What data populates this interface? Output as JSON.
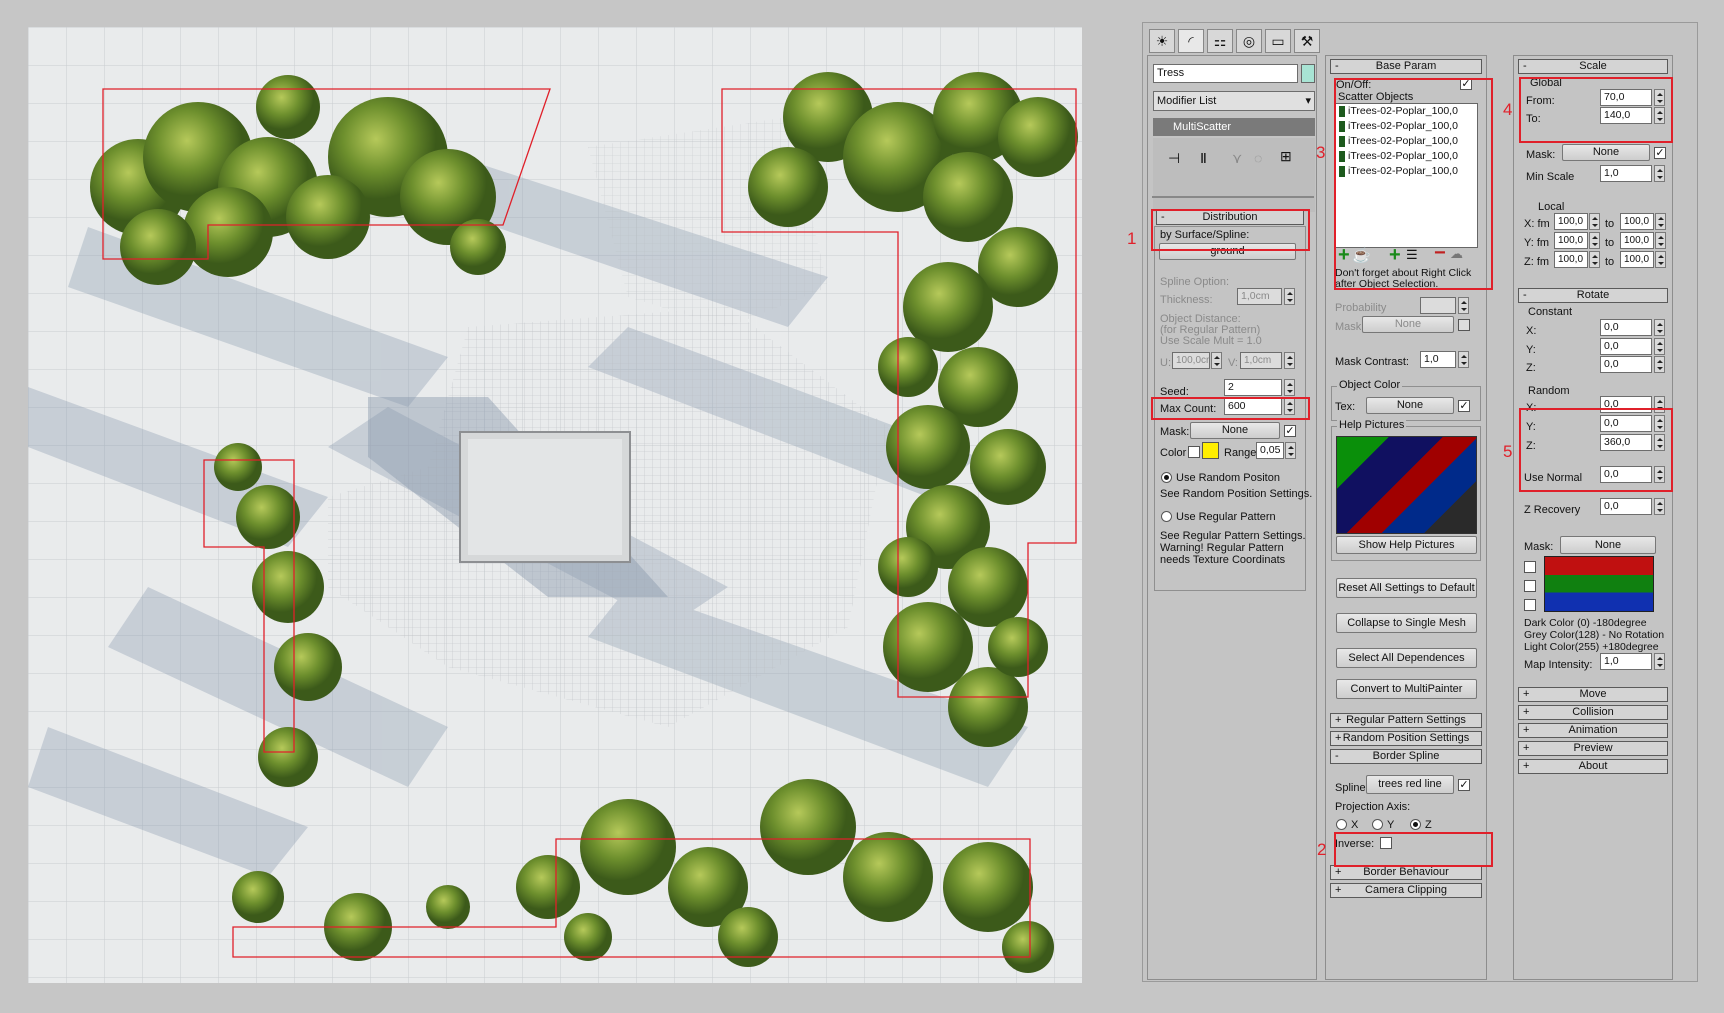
{
  "tabs": [
    "create-tab",
    "modify-tab",
    "hierarchy-tab",
    "motion-tab",
    "display-tab",
    "utilities-tab"
  ],
  "object_name": "Tress",
  "object_color": "#a8e4d4",
  "modifier_list": "Modifier List",
  "modifier_stack_item": "MultiScatter",
  "distribution": {
    "title": "Distribution",
    "by_surface_label": "by Surface/Spline:",
    "surface_button": "ground",
    "spline_option": "Spline Option:",
    "thickness_label": "Thickness:",
    "thickness_value": "1,0cm",
    "object_distance": "Object Distance:",
    "for_regular": "(for Regular Pattern)",
    "use_scale": "Use Scale Mult = 1.0",
    "u_label": "U:",
    "u_value": "100,0cr",
    "v_label": "V:",
    "v_value": "1,0cm",
    "seed_label": "Seed:",
    "seed_value": "2",
    "maxcount_label": "Max Count:",
    "maxcount_value": "600",
    "mask_label": "Mask:",
    "mask_value": "None",
    "color_label": "Color",
    "color_swatch": "#ffee00",
    "range_label": "Range",
    "range_value": "0,05",
    "use_random": "Use Random Positon",
    "see_random": "See Random Position Settings.",
    "use_regular": "Use Regular Pattern",
    "see_regular_1": "See Regular Pattern Settings.",
    "see_regular_2": "Warning! Regular Pattern",
    "see_regular_3": "needs Texture Coordinats"
  },
  "base": {
    "title": "Base Param",
    "onoff": "On/Off:",
    "scatter_objects": "Scatter Objects",
    "items": [
      "iTrees-02-Poplar_100,0",
      "iTrees-02-Poplar_100,0",
      "iTrees-02-Poplar_100,0",
      "iTrees-02-Poplar_100,0",
      "iTrees-02-Poplar_100,0"
    ],
    "note_1": "Don't forget about Right Click",
    "note_2": "after Object Selection.",
    "probability": "Probability",
    "mask_label": "Mask",
    "mask_value": "None",
    "mask_contrast": "Mask Contrast:",
    "mask_contrast_value": "1,0",
    "object_color": "Object Color",
    "tex_label": "Tex:",
    "tex_value": "None",
    "help_pictures": "Help Pictures",
    "show_help": "Show Help Pictures",
    "reset": "Reset All Settings to Default",
    "collapse": "Collapse to Single Mesh",
    "select_all": "Select All Dependences",
    "convert": "Convert to MultiPainter",
    "regular_pattern": "Regular Pattern Settings",
    "random_position": "Random Position Settings",
    "border_spline": "Border Spline",
    "spline_label": "Spline:",
    "spline_value": "trees red line",
    "projection_axis": "Projection Axis:",
    "axis_x": "X",
    "axis_y": "Y",
    "axis_z": "Z",
    "inverse": "Inverse:",
    "border_behaviour": "Border Behaviour",
    "camera_clipping": "Camera Clipping"
  },
  "scale": {
    "title": "Scale",
    "global": "Global",
    "from_label": "From:",
    "from_value": "70,0",
    "to_label": "To:",
    "to_value": "140,0",
    "mask_label": "Mask:",
    "mask_value": "None",
    "min_scale": "Min Scale",
    "min_scale_value": "1,0",
    "local": "Local",
    "x_fm": "X: fm",
    "y_fm": "Y: fm",
    "z_fm": "Z: fm",
    "to": "to",
    "local_value": "100,0"
  },
  "rotate": {
    "title": "Rotate",
    "constant": "Constant",
    "x": "X:",
    "y": "Y:",
    "z": "Z:",
    "zero": "0,0",
    "random": "Random",
    "rx": "0,0",
    "ry": "0,0",
    "rz": "360,0",
    "use_normal": "Use Normal",
    "use_normal_value": "0,0",
    "z_recovery": "Z Recovery",
    "z_recovery_value": "0,0",
    "mask_label": "Mask:",
    "mask_value": "None",
    "dark": "Dark Color (0)   -180degree",
    "grey": "Grey Color(128) - No Rotation",
    "light": "Light Color(255)  +180degree",
    "map_intensity": "Map Intensity:",
    "map_intensity_value": "1,0"
  },
  "rollouts_right": [
    "Move",
    "Collision",
    "Animation",
    "Preview",
    "About"
  ],
  "annotations": [
    "1",
    "2",
    "3",
    "4",
    "5"
  ]
}
